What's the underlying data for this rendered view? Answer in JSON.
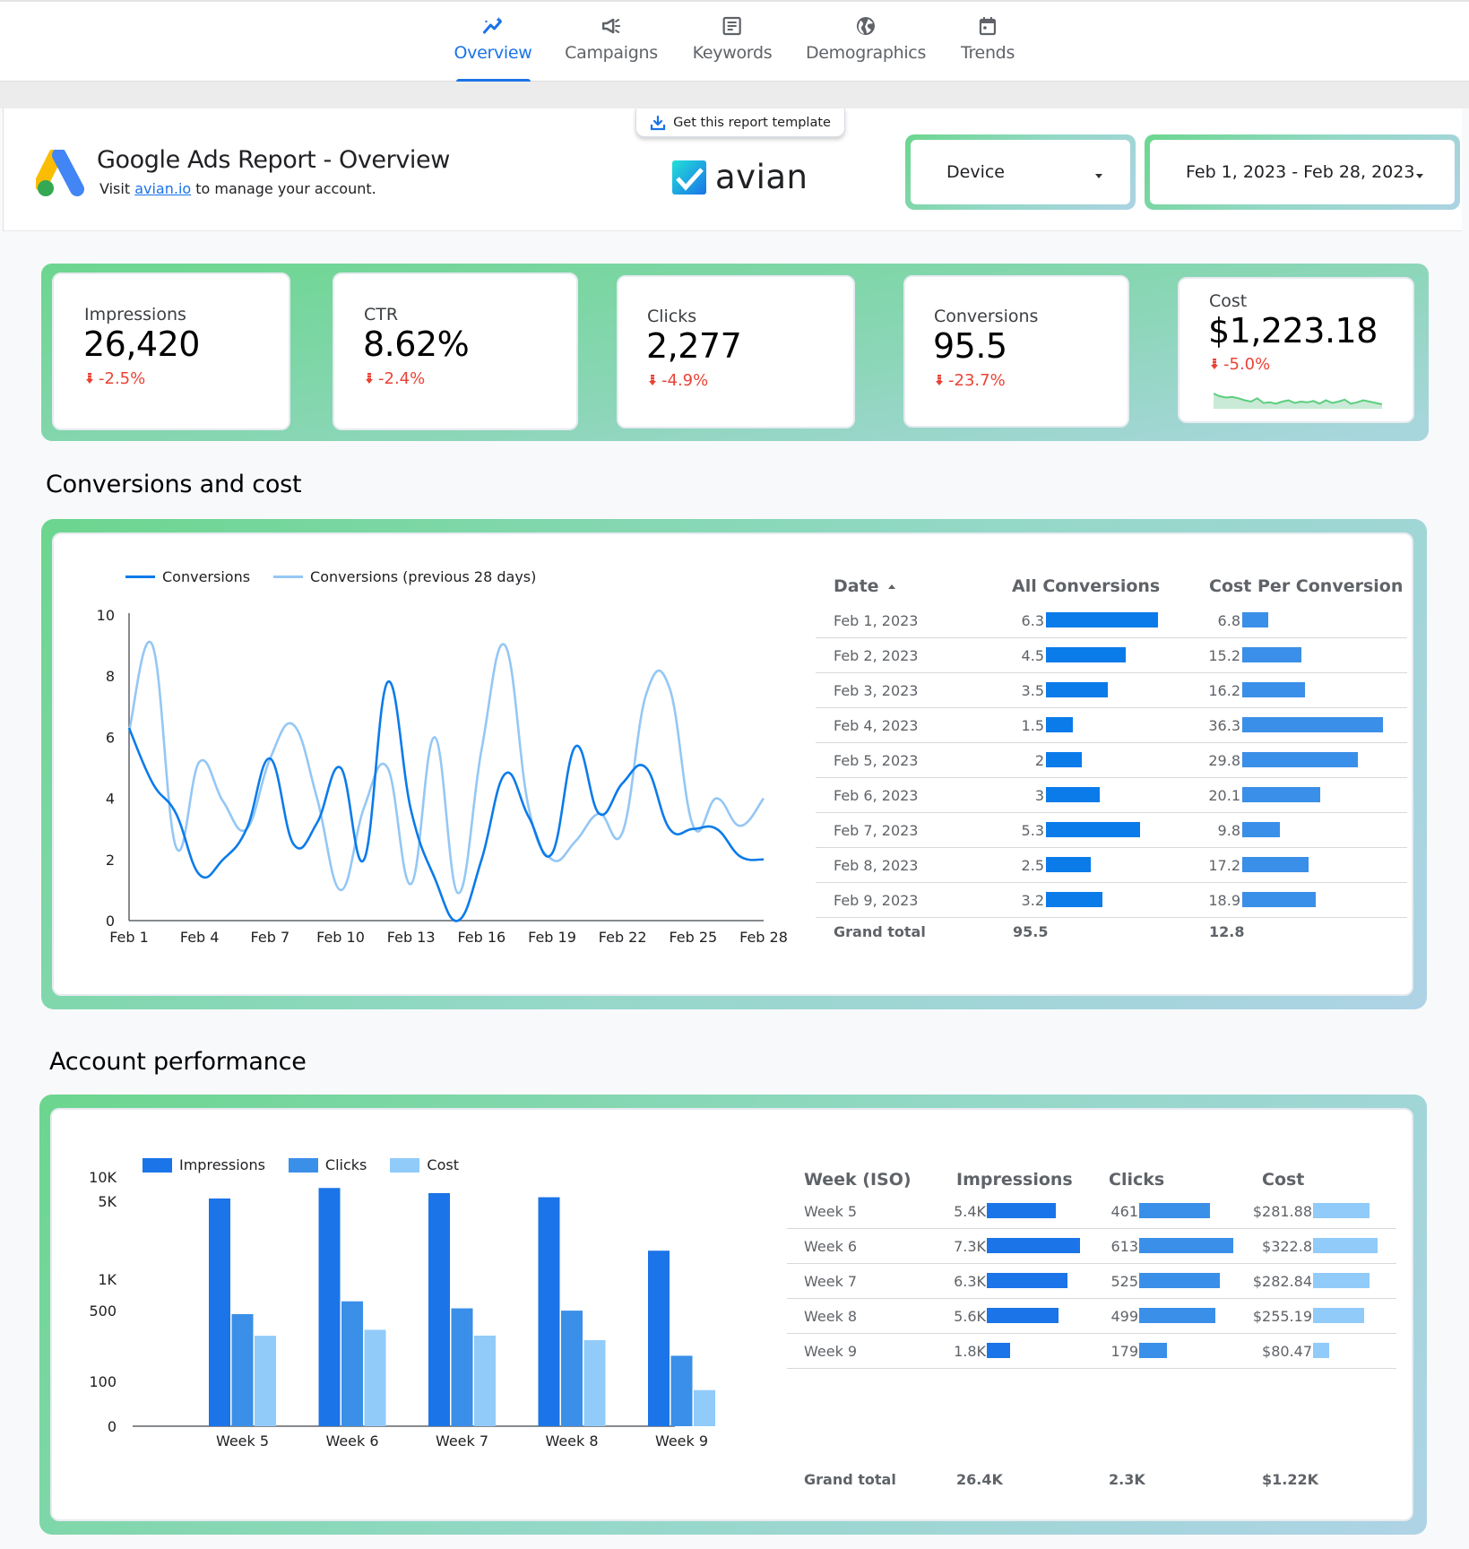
{
  "nav": {
    "tabs": [
      {
        "label": "Overview",
        "icon": "sparkline-chart-icon",
        "active": true
      },
      {
        "label": "Campaigns",
        "icon": "megaphone-icon",
        "active": false
      },
      {
        "label": "Keywords",
        "icon": "document-list-icon",
        "active": false
      },
      {
        "label": "Demographics",
        "icon": "globe-icon",
        "active": false
      },
      {
        "label": "Trends",
        "icon": "calendar-icon",
        "active": false
      }
    ]
  },
  "header": {
    "title": "Google Ads Report - Overview",
    "subtitle_prefix": "Visit ",
    "subtitle_link": "avian.io",
    "subtitle_suffix": " to manage your account.",
    "template_button": "Get this report template",
    "brand": "avian",
    "device_filter": "Device",
    "date_range": "Feb 1, 2023 - Feb 28, 2023"
  },
  "colors": {
    "accent": "#1a73e8",
    "negative": "#ea4335",
    "series_primary": "#0b7bea",
    "series_previous": "#94c7f5",
    "clicks": "#3a8fe8",
    "cost": "#91cbfa",
    "gradient_start": "#6bd68e",
    "gradient_end": "#aed3e6"
  },
  "kpis": [
    {
      "label": "Impressions",
      "value": "26,420",
      "delta": "-2.5%",
      "direction": "down"
    },
    {
      "label": "CTR",
      "value": "8.62%",
      "delta": "-2.4%",
      "direction": "down"
    },
    {
      "label": "Clicks",
      "value": "2,277",
      "delta": "-4.9%",
      "direction": "down"
    },
    {
      "label": "Conversions",
      "value": "95.5",
      "delta": "-23.7%",
      "direction": "down"
    },
    {
      "label": "Cost",
      "value": "$1,223.18",
      "delta": "-5.0%",
      "direction": "down",
      "sparkline": [
        62,
        58,
        56,
        57,
        55,
        52,
        50,
        55,
        48,
        49,
        47,
        50,
        52,
        48,
        50,
        49,
        51,
        47,
        52,
        48,
        50,
        53,
        47,
        49,
        52,
        50,
        48,
        46
      ]
    }
  ],
  "sections": {
    "conversions_title": "Conversions and cost",
    "account_title": "Account performance"
  },
  "conversions_table": {
    "headers": [
      "Date",
      "All Conversions",
      "Cost Per Conversion"
    ],
    "rows": [
      {
        "date": "Feb 1, 2023",
        "conversions": 6.3,
        "conversions_label": "6.3",
        "cpc": 6.8,
        "cpc_label": "6.8"
      },
      {
        "date": "Feb 2, 2023",
        "conversions": 4.5,
        "conversions_label": "4.5",
        "cpc": 15.2,
        "cpc_label": "15.2"
      },
      {
        "date": "Feb 3, 2023",
        "conversions": 3.5,
        "conversions_label": "3.5",
        "cpc": 16.2,
        "cpc_label": "16.2"
      },
      {
        "date": "Feb 4, 2023",
        "conversions": 1.5,
        "conversions_label": "1.5",
        "cpc": 36.3,
        "cpc_label": "36.3"
      },
      {
        "date": "Feb 5, 2023",
        "conversions": 2,
        "conversions_label": "2",
        "cpc": 29.8,
        "cpc_label": "29.8"
      },
      {
        "date": "Feb 6, 2023",
        "conversions": 3,
        "conversions_label": "3",
        "cpc": 20.1,
        "cpc_label": "20.1"
      },
      {
        "date": "Feb 7, 2023",
        "conversions": 5.3,
        "conversions_label": "5.3",
        "cpc": 9.8,
        "cpc_label": "9.8"
      },
      {
        "date": "Feb 8, 2023",
        "conversions": 2.5,
        "conversions_label": "2.5",
        "cpc": 17.2,
        "cpc_label": "17.2"
      },
      {
        "date": "Feb 9, 2023",
        "conversions": 3.2,
        "conversions_label": "3.2",
        "cpc": 18.9,
        "cpc_label": "18.9"
      }
    ],
    "total_label": "Grand total",
    "total_conversions": "95.5",
    "total_cpc": "12.8"
  },
  "weekly_table": {
    "headers": [
      "Week (ISO)",
      "Impressions",
      "Clicks",
      "Cost"
    ],
    "rows": [
      {
        "week": "Week 5",
        "impressions": 5400,
        "impressions_label": "5.4K",
        "clicks": 461,
        "clicks_label": "461",
        "cost": 281.88,
        "cost_label": "$281.88"
      },
      {
        "week": "Week 6",
        "impressions": 7300,
        "impressions_label": "7.3K",
        "clicks": 613,
        "clicks_label": "613",
        "cost": 322.8,
        "cost_label": "$322.8"
      },
      {
        "week": "Week 7",
        "impressions": 6300,
        "impressions_label": "6.3K",
        "clicks": 525,
        "clicks_label": "525",
        "cost": 282.84,
        "cost_label": "$282.84"
      },
      {
        "week": "Week 8",
        "impressions": 5600,
        "impressions_label": "5.6K",
        "clicks": 499,
        "clicks_label": "499",
        "cost": 255.19,
        "cost_label": "$255.19"
      },
      {
        "week": "Week 9",
        "impressions": 1800,
        "impressions_label": "1.8K",
        "clicks": 179,
        "clicks_label": "179",
        "cost": 80.47,
        "cost_label": "$80.47"
      }
    ],
    "total_label": "Grand total",
    "total_impressions": "26.4K",
    "total_clicks": "2.3K",
    "total_cost": "$1.22K"
  },
  "chart_data": [
    {
      "type": "line",
      "title": "",
      "xlabel": "",
      "ylabel": "",
      "x": [
        "Feb 1",
        "Feb 2",
        "Feb 3",
        "Feb 4",
        "Feb 5",
        "Feb 6",
        "Feb 7",
        "Feb 8",
        "Feb 9",
        "Feb 10",
        "Feb 11",
        "Feb 12",
        "Feb 13",
        "Feb 14",
        "Feb 15",
        "Feb 16",
        "Feb 17",
        "Feb 18",
        "Feb 19",
        "Feb 20",
        "Feb 21",
        "Feb 22",
        "Feb 23",
        "Feb 24",
        "Feb 25",
        "Feb 26",
        "Feb 27",
        "Feb 28"
      ],
      "x_tick_labels": [
        "Feb 1",
        "Feb 4",
        "Feb 7",
        "Feb 10",
        "Feb 13",
        "Feb 16",
        "Feb 19",
        "Feb 22",
        "Feb 25",
        "Feb 28"
      ],
      "ylim": [
        0,
        10
      ],
      "y_ticks": [
        0,
        2,
        4,
        6,
        8,
        10
      ],
      "grid": false,
      "legend": "top-left",
      "series": [
        {
          "name": "Conversions",
          "values": [
            6.3,
            4.5,
            3.5,
            1.5,
            2,
            3,
            5.3,
            2.5,
            3.2,
            5.0,
            2.0,
            7.8,
            3.6,
            1.4,
            0,
            2.0,
            4.8,
            3.4,
            2.2,
            5.7,
            3.5,
            4.5,
            5.0,
            3.0,
            3.0,
            3.0,
            2.1,
            2.0
          ]
        },
        {
          "name": "Conversions (previous 28 days)",
          "values": [
            6.2,
            9.0,
            2.4,
            5.2,
            3.9,
            3.0,
            5.3,
            6.4,
            4.0,
            1.0,
            3.7,
            5.0,
            1.2,
            6.0,
            0.9,
            5.6,
            9.0,
            3.7,
            2.0,
            2.6,
            3.5,
            2.9,
            7.4,
            7.6,
            3.1,
            4.0,
            3.1,
            4.0
          ]
        }
      ]
    },
    {
      "type": "bar",
      "title": "",
      "xlabel": "",
      "ylabel": "",
      "y_scale": "log",
      "categories": [
        "Week 5",
        "Week 6",
        "Week 7",
        "Week 8",
        "Week 9"
      ],
      "y_ticks": [
        "0",
        "100",
        "500",
        "1K",
        "5K",
        "10K"
      ],
      "legend": "top-left",
      "series": [
        {
          "name": "Impressions",
          "values": [
            5400,
            7300,
            6300,
            5600,
            1800
          ]
        },
        {
          "name": "Clicks",
          "values": [
            461,
            613,
            525,
            499,
            179
          ]
        },
        {
          "name": "Cost",
          "values": [
            281.88,
            322.8,
            282.84,
            255.19,
            80.47
          ]
        }
      ]
    }
  ]
}
